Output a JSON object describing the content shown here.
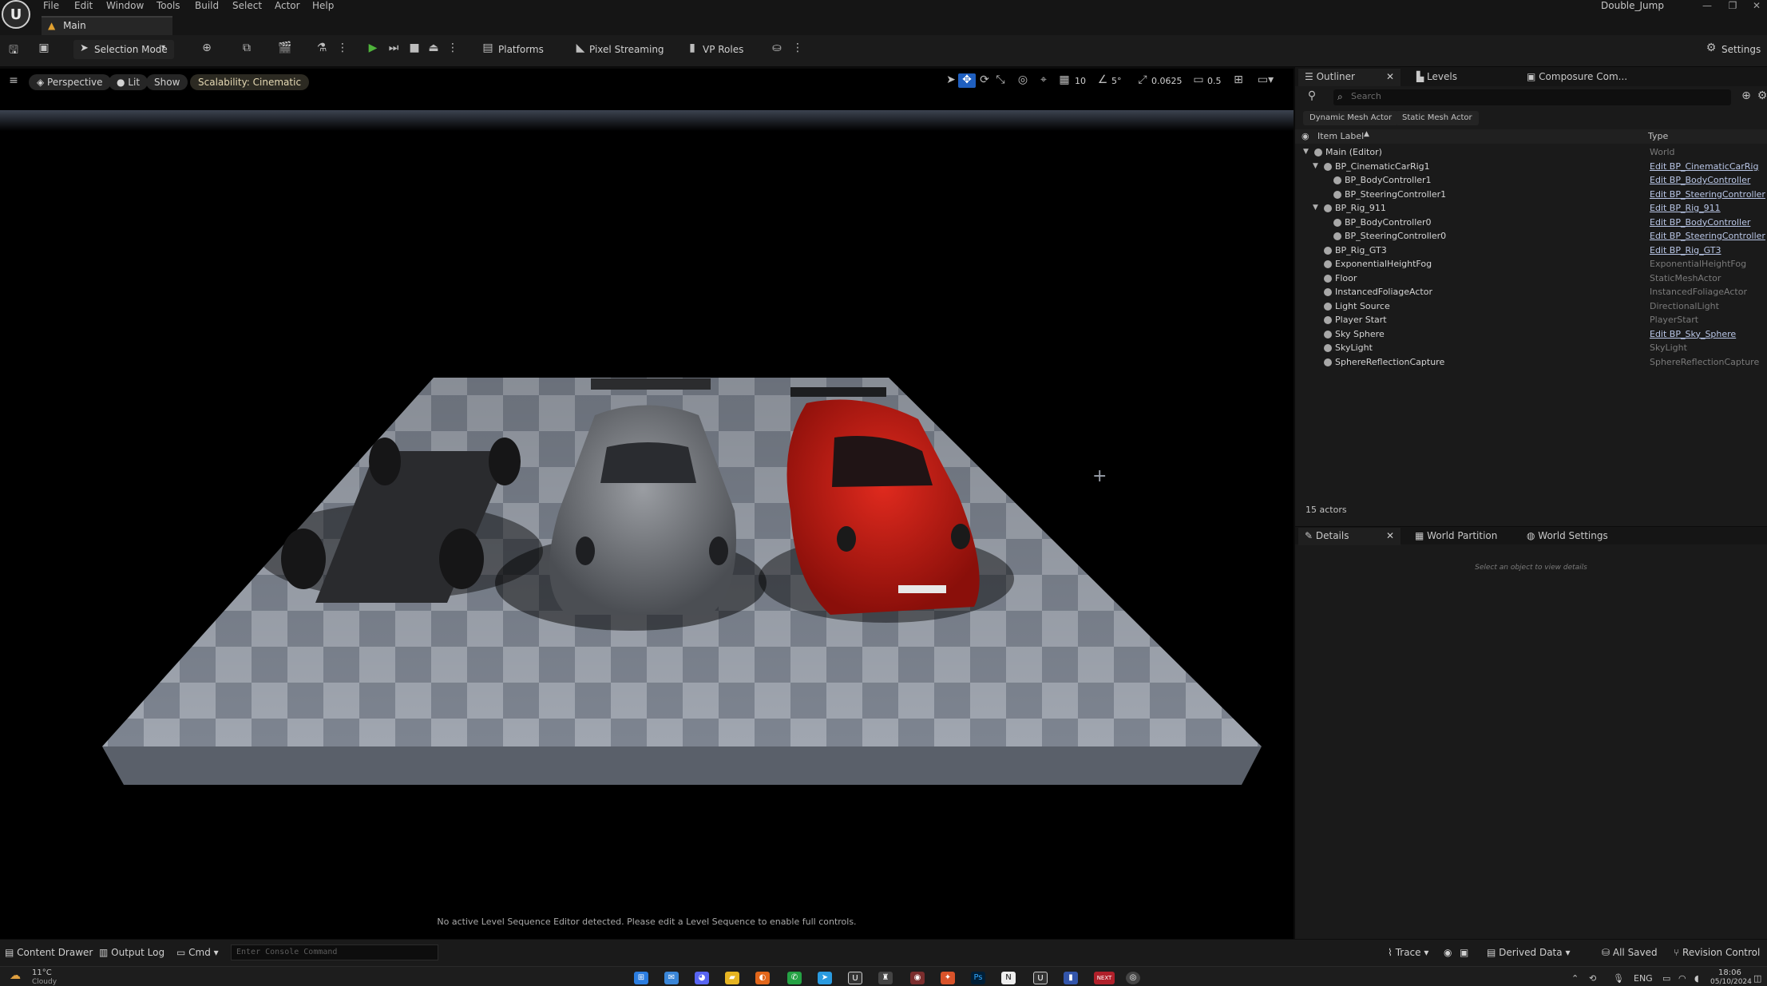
{
  "menu": [
    "File",
    "Edit",
    "Window",
    "Tools",
    "Build",
    "Select",
    "Actor",
    "Help"
  ],
  "window_title": "Double_Jump",
  "tab": {
    "label": "Main"
  },
  "toolbar": {
    "selection_mode": "Selection Mode",
    "platforms": "Platforms",
    "pixel_streaming": "Pixel Streaming",
    "vp_roles": "VP Roles",
    "settings": "Settings"
  },
  "viewport": {
    "perspective": "Perspective",
    "lit": "Lit",
    "show": "Show",
    "scalability": "Scalability: Cinematic",
    "grid_snap": "10",
    "rotation_snap": "5°",
    "scale_snap": "0.0625",
    "camera_speed": "0.5",
    "hint": "No active Level Sequence Editor detected. Please edit a Level Sequence to enable full controls."
  },
  "outliner": {
    "tabs": [
      "Outliner",
      "Levels",
      "Composure Com..."
    ],
    "search_placeholder": "Search",
    "filters": [
      "Dynamic Mesh Actor",
      "Static Mesh Actor"
    ],
    "col_label": "Item Label",
    "col_type": "Type",
    "rows": [
      {
        "label": "Main (Editor)",
        "type": "World"
      },
      {
        "label": "BP_CinematicCarRig1",
        "type": "Edit BP_CinematicCarRig"
      },
      {
        "label": "BP_BodyController1",
        "type": "Edit BP_BodyController"
      },
      {
        "label": "BP_SteeringController1",
        "type": "Edit BP_SteeringController"
      },
      {
        "label": "BP_Rig_911",
        "type": "Edit BP_Rig_911"
      },
      {
        "label": "BP_BodyController0",
        "type": "Edit BP_BodyController"
      },
      {
        "label": "BP_SteeringController0",
        "type": "Edit BP_SteeringController"
      },
      {
        "label": "BP_Rig_GT3",
        "type": "Edit BP_Rig_GT3"
      },
      {
        "label": "ExponentialHeightFog",
        "type": "ExponentialHeightFog"
      },
      {
        "label": "Floor",
        "type": "StaticMeshActor"
      },
      {
        "label": "InstancedFoliageActor",
        "type": "InstancedFoliageActor"
      },
      {
        "label": "Light Source",
        "type": "DirectionalLight"
      },
      {
        "label": "Player Start",
        "type": "PlayerStart"
      },
      {
        "label": "Sky Sphere",
        "type": "Edit BP_Sky_Sphere"
      },
      {
        "label": "SkyLight",
        "type": "SkyLight"
      },
      {
        "label": "SphereReflectionCapture",
        "type": "SphereReflectionCapture"
      }
    ],
    "actor_count": "15 actors"
  },
  "details": {
    "tabs": [
      "Details",
      "World Partition",
      "World Settings"
    ],
    "empty": "Select an object to view details"
  },
  "statusbar": {
    "content_drawer": "Content Drawer",
    "output_log": "Output Log",
    "cmd": "Cmd",
    "console_placeholder": "Enter Console Command",
    "trace": "Trace",
    "derived_data": "Derived Data",
    "all_saved": "All Saved",
    "revision_control": "Revision Control"
  },
  "taskbar": {
    "weather_temp": "11°C",
    "weather_desc": "Cloudy",
    "lang": "ENG",
    "time": "18:06",
    "date": "05/10/2024"
  },
  "colors": {
    "accent_play": "#4fb33b",
    "link": "#b9c6e6",
    "car_red": "#c21a13"
  }
}
